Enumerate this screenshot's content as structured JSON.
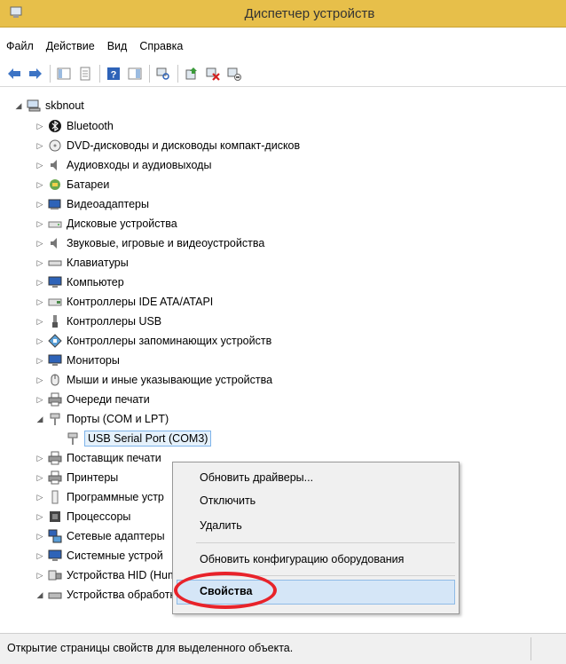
{
  "window": {
    "title": "Диспетчер устройств"
  },
  "menu": [
    "Файл",
    "Действие",
    "Вид",
    "Справка"
  ],
  "toolbar_icons": [
    "back-arrow-icon",
    "forward-arrow-icon",
    "console-tree-icon",
    "properties-page-icon",
    "help-icon",
    "details-view-icon",
    "scan-hardware-icon",
    "update-driver-icon",
    "uninstall-icon",
    "disable-device-icon"
  ],
  "tree": {
    "root": "skbnout",
    "categories": [
      "Bluetooth",
      "DVD-дисководы и дисководы компакт-дисков",
      "Аудиовходы и аудиовыходы",
      "Батареи",
      "Видеоадаптеры",
      "Дисковые устройства",
      "Звуковые, игровые и видеоустройства",
      "Клавиатуры",
      "Компьютер",
      "Контроллеры IDE ATA/ATAPI",
      "Контроллеры USB",
      "Контроллеры запоминающих устройств",
      "Мониторы",
      "Мыши и иные указывающие устройства",
      "Очереди печати",
      "Порты (COM и LPT)"
    ],
    "selected_child": "USB Serial Port (COM3)",
    "categories_after": [
      "Поставщик печати",
      "Принтеры",
      "Программные устр",
      "Процессоры",
      "Сетевые адаптеры",
      "Системные устрой",
      "Устройства HID (Hum",
      "Устройства обработки изображений"
    ]
  },
  "context_menu": {
    "items": [
      "Обновить драйверы...",
      "Отключить",
      "Удалить",
      "Обновить конфигурацию оборудования",
      "Свойства"
    ]
  },
  "status": {
    "text": "Открытие страницы свойств для выделенного объекта."
  },
  "colors": {
    "titlebar": "#e7bf4a",
    "highlight": "#d5e6f7",
    "annotation": "#e8232a"
  }
}
